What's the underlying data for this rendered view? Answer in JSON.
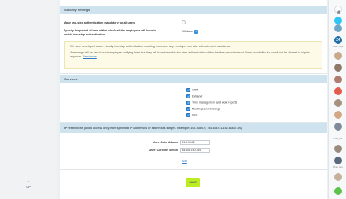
{
  "security": {
    "header": "Security settings",
    "mandatory_label": "Make two-step authentication mandatory for all users",
    "period_label": "Specify the period of time within which all the employees will have to enable two-step authentication",
    "period_value": "10 days",
    "notice_p1": "We have developed a user friendly two-step authentication enabling procedure any employee can take without expert assistance.",
    "notice_p2": "A message will be sent to each employee notifying them that they will have to enable two-step authentication within the time period entered. Users who fail to do so will not be allowed to sign in anymore.",
    "read_more": "Read more"
  },
  "services": {
    "header": "Services",
    "items": [
      "CRM",
      "Extranet",
      "Time management and work reports",
      "Meetings and briefings",
      "Lists"
    ]
  },
  "ip": {
    "header": "IP restrictions (allow access only from specified IP addresses or addresses ranges. Example: 192.168.0.7; 192.168.0.1-192.168.0.100)",
    "rows": [
      {
        "user": "User: John Adams",
        "value": "91.9.154.2"
      },
      {
        "user": "User: Caroline Simon",
        "value": "84.108.100.154"
      }
    ],
    "add_label": "Add"
  },
  "save_label": "SAVE",
  "up_label": "UP",
  "right_bar": {
    "badge": "24",
    "names": [
      "Shan. Dept.",
      "Chat_Hul.",
      "Shan. Aug.",
      "Shan. Dept."
    ],
    "colors": {
      "brand": "#2fc6f6",
      "badge": "#1d6fa5",
      "green": "#5cc34a"
    }
  }
}
